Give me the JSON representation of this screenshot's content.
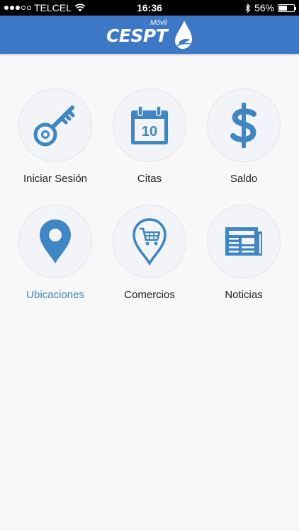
{
  "status_bar": {
    "carrier": "TELCEL",
    "time": "16:36",
    "battery_percent": "56%",
    "battery_level": 0.56,
    "signal_bars": 3,
    "signal_total": 5
  },
  "header": {
    "logo_text": "CESPT",
    "logo_sub": "Móvil",
    "background_color": "#3d78c6"
  },
  "menu": {
    "items": [
      {
        "label": "Iniciar Sesión",
        "icon": "key-icon",
        "active": false
      },
      {
        "label": "Citas",
        "icon": "calendar-icon",
        "calendar_day": "10",
        "active": false
      },
      {
        "label": "Saldo",
        "icon": "dollar-icon",
        "active": false
      },
      {
        "label": "Ubicaciones",
        "icon": "location-pin-icon",
        "active": true
      },
      {
        "label": "Comercios",
        "icon": "shopping-cart-icon",
        "active": false
      },
      {
        "label": "Noticias",
        "icon": "newspaper-icon",
        "active": false
      }
    ],
    "icon_color": "#3f87c4",
    "active_label_color": "#3f87c4"
  }
}
